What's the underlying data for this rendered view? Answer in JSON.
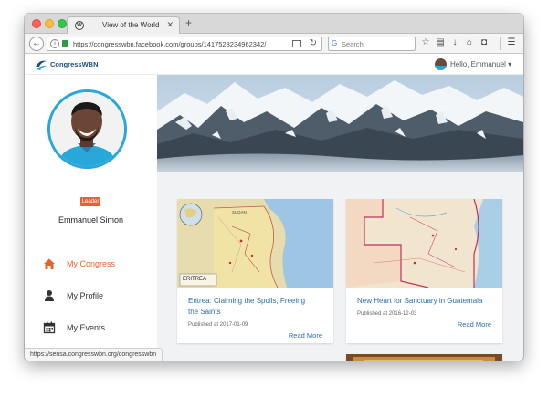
{
  "browser": {
    "tab_title": "View of the World",
    "new_tab_symbol": "+",
    "url": "https://congresswbn.facebook.com/groups/1417528234962342/",
    "search_placeholder": "Search",
    "status_url": "https://sensa.congresswbn.org/congresswbn"
  },
  "site": {
    "logo_text": "CongressWBN",
    "greeting": "Hello, Emmanuel",
    "accent": "#e8632c",
    "link_color": "#2a6fa8",
    "ring_color": "#2ba6d9"
  },
  "profile": {
    "badge": "Leader",
    "name": "Emmanuel Simon"
  },
  "sidebar": {
    "items": [
      {
        "label": "My Congress",
        "icon": "home-icon",
        "active": true
      },
      {
        "label": "My Profile",
        "icon": "person-icon",
        "active": false
      },
      {
        "label": "My Events",
        "icon": "calendar-icon",
        "active": false
      }
    ]
  },
  "posts": [
    {
      "title_line1": "Eritrea: Claiming the Spoils, Freeing",
      "title_line2": "the Saints",
      "date": "Published at 2017-01-09",
      "link": "Read More",
      "map_label": "ERITREA",
      "map_sub": "SUDAN"
    },
    {
      "title_line1": "New Heart for Sanctuary in Guatemala",
      "title_line2": "",
      "date": "Published at 2016-12-03",
      "link": "Read More"
    }
  ]
}
